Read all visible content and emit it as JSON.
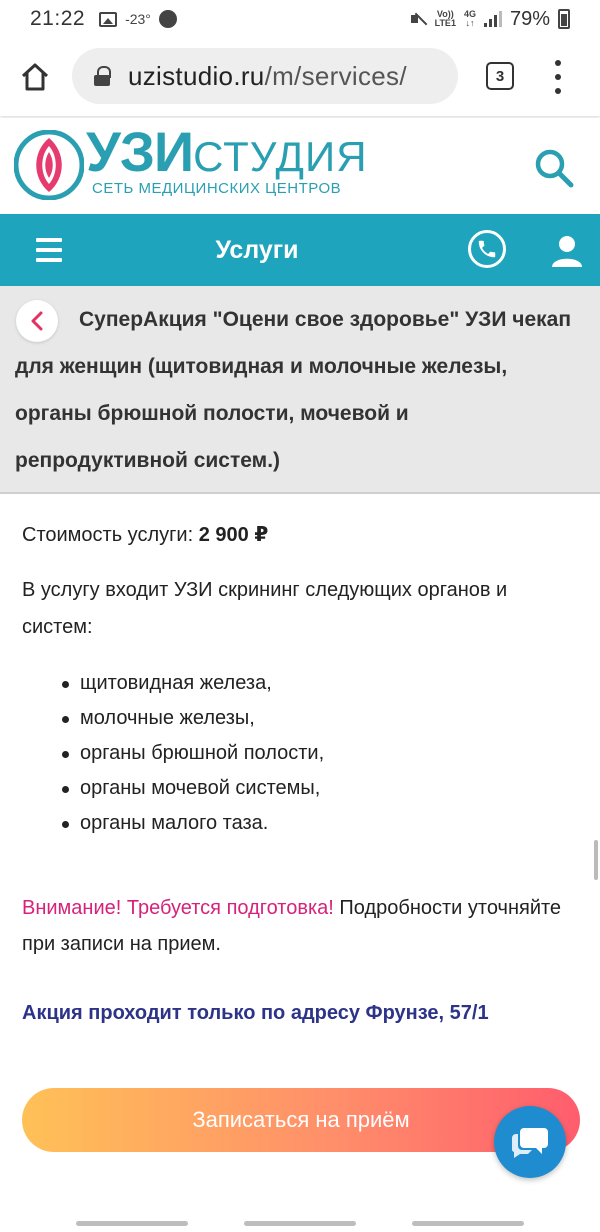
{
  "status_bar": {
    "time": "21:22",
    "temperature": "-23°",
    "network_top": "Vo))",
    "network_bottom": "LTE1",
    "data_top": "4G",
    "data_bottom": "↓↑",
    "battery": "79%"
  },
  "browser": {
    "url_host": "uzistudio.ru",
    "url_path": "/m/services/",
    "tab_count": "3"
  },
  "site_header": {
    "logo_main": "УЗИ",
    "logo_suffix": "СТУДИЯ",
    "logo_subtitle": "СЕТЬ МЕДИЦИНСКИХ ЦЕНТРОВ",
    "brand_color": "#2a9fb2"
  },
  "nav": {
    "title": "Услуги",
    "bar_color": "#1fa4bd"
  },
  "service": {
    "title": "СуперАкция \"Оцени свое здоровье\" УЗИ чекап для женщин (щитовидная и молочные железы, органы брюшной полости, мочевой и репродуктивной систем.)",
    "price_label": "Стоимость услуги:",
    "price_value": "2 900 ₽",
    "intro": "В услугу входит УЗИ скрининг следующих органов и систем:",
    "organs": [
      "щитовидная железа,",
      "молочные железы,",
      "органы брюшной полости,",
      "органы мочевой системы,",
      "органы малого таза."
    ],
    "warning_alert": "Внимание! Требуется подготовка!",
    "warning_text": " Подробности уточняйте при записи на прием.",
    "promo_note": "Акция проходит только по адресу Фрунзе, 57/1"
  },
  "cta": {
    "label": "Записаться на приём"
  },
  "colors": {
    "alert": "#d6227b",
    "promo": "#2d3488",
    "chat": "#1f8ccf"
  }
}
